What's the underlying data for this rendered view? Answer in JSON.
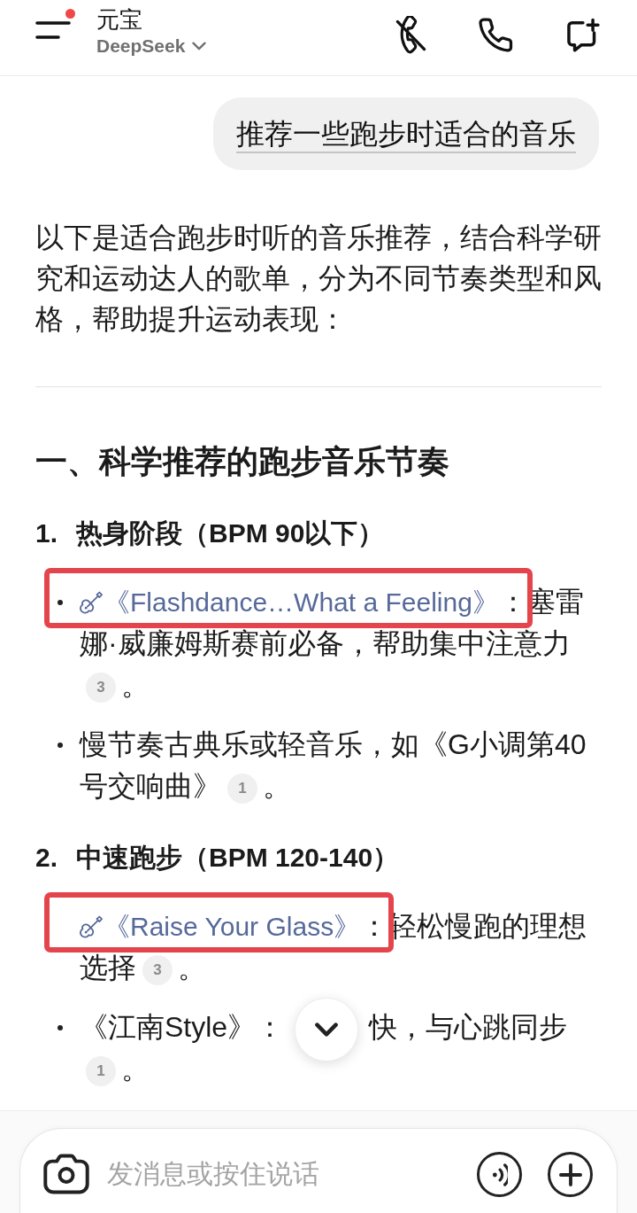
{
  "header": {
    "title": "元宝",
    "model": "DeepSeek",
    "notification_dot": true
  },
  "user_message": {
    "text": "推荐一些跑步时适合的音乐"
  },
  "answer": {
    "intro": "以下是适合跑步时听的音乐推荐，结合科学研究和运动达人的歌单，分为不同节奏类型和风格，帮助提升运动表现：",
    "sections": [
      {
        "heading": "一、科学推荐的跑步音乐节奏",
        "groups": [
          {
            "number": "1.",
            "title": "热身阶段（BPM 90以下）",
            "items": [
              {
                "kind": "song",
                "bullet": true,
                "highlighted": true,
                "song": "《Flashdance…What a Feeling》",
                "segments": [
                  "：塞雷娜·威廉姆斯赛前必备，帮助集中注意力"
                ],
                "citation": "3",
                "end": "。"
              },
              {
                "kind": "plain",
                "bullet": true,
                "highlighted": false,
                "segments": [
                  "慢节奏古典乐或轻音乐，如《G小调第40号交响曲》"
                ],
                "citation": "1",
                "end": "。"
              }
            ]
          },
          {
            "number": "2.",
            "title": "中速跑步（BPM 120-140）",
            "items": [
              {
                "kind": "song",
                "bullet": false,
                "highlighted": true,
                "song": "《Raise Your Glass》",
                "segments": [
                  "：轻松慢跑的理想选择"
                ],
                "citation": "3",
                "end": "。"
              },
              {
                "kind": "plain",
                "bullet": true,
                "highlighted": false,
                "segments": [
                  "《江南Style》：",
                  "快，与心跳同步"
                ],
                "citation": "1",
                "end": "。"
              }
            ]
          }
        ]
      }
    ]
  },
  "composer": {
    "placeholder": "发消息或按住说话"
  }
}
